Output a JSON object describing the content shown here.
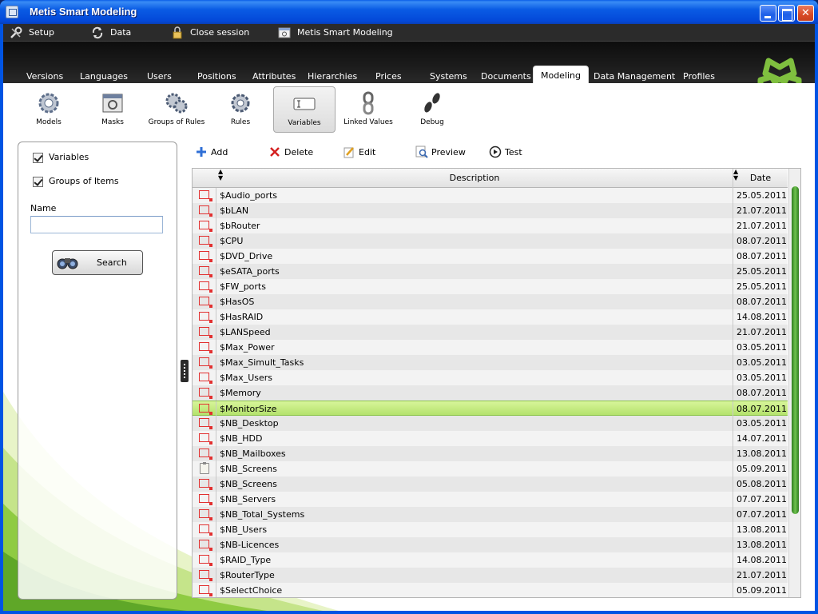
{
  "window": {
    "title": "Metis Smart Modeling"
  },
  "menu": [
    {
      "label": "Setup",
      "icon": "tools-icon"
    },
    {
      "label": "Data",
      "icon": "refresh-icon"
    },
    {
      "label": "Close session",
      "icon": "lock-icon"
    },
    {
      "label": "Metis Smart Modeling",
      "icon": "app-window-icon"
    }
  ],
  "tabs": [
    "Versions",
    "Languages",
    "Users",
    "Positions",
    "Attributes",
    "Hierarchies",
    "Prices",
    "Systems",
    "Documents",
    "Modeling",
    "Data Management",
    "Profiles"
  ],
  "active_tab": "Modeling",
  "ribbon": [
    {
      "label": "Models",
      "icon": "gear-models-icon"
    },
    {
      "label": "Masks",
      "icon": "mask-icon"
    },
    {
      "label": "Groups of Rules",
      "icon": "gears-group-icon"
    },
    {
      "label": "Rules",
      "icon": "gear-rules-icon"
    },
    {
      "label": "Variables",
      "icon": "variable-field-icon"
    },
    {
      "label": "Linked Values",
      "icon": "chain-link-icon"
    },
    {
      "label": "Debug",
      "icon": "footsteps-icon"
    }
  ],
  "active_ribbon": "Variables",
  "filter": {
    "variables_label": "Variables",
    "variables_checked": true,
    "groups_label": "Groups of Items",
    "groups_checked": true,
    "name_label": "Name",
    "name_value": "",
    "search_label": "Search"
  },
  "actions": {
    "add": "Add",
    "delete": "Delete",
    "edit": "Edit",
    "preview": "Preview",
    "test": "Test"
  },
  "table": {
    "col_description": "Description",
    "col_date": "Date",
    "rows": [
      {
        "desc": "$Audio_ports",
        "date": "25.05.2011",
        "icon": "variable"
      },
      {
        "desc": "$bLAN",
        "date": "21.07.2011",
        "icon": "variable"
      },
      {
        "desc": "$bRouter",
        "date": "21.07.2011",
        "icon": "variable"
      },
      {
        "desc": "$CPU",
        "date": "08.07.2011",
        "icon": "variable"
      },
      {
        "desc": "$DVD_Drive",
        "date": "08.07.2011",
        "icon": "variable"
      },
      {
        "desc": "$eSATA_ports",
        "date": "25.05.2011",
        "icon": "variable"
      },
      {
        "desc": "$FW_ports",
        "date": "25.05.2011",
        "icon": "variable"
      },
      {
        "desc": "$HasOS",
        "date": "08.07.2011",
        "icon": "variable"
      },
      {
        "desc": "$HasRAID",
        "date": "14.08.2011",
        "icon": "variable"
      },
      {
        "desc": "$LANSpeed",
        "date": "21.07.2011",
        "icon": "variable"
      },
      {
        "desc": "$Max_Power",
        "date": "03.05.2011",
        "icon": "variable"
      },
      {
        "desc": "$Max_Simult_Tasks",
        "date": "03.05.2011",
        "icon": "variable"
      },
      {
        "desc": "$Max_Users",
        "date": "03.05.2011",
        "icon": "variable"
      },
      {
        "desc": "$Memory",
        "date": "08.07.2011",
        "icon": "variable"
      },
      {
        "desc": "$MonitorSize",
        "date": "08.07.2011",
        "icon": "variable",
        "selected": true
      },
      {
        "desc": "$NB_Desktop",
        "date": "03.05.2011",
        "icon": "variable"
      },
      {
        "desc": "$NB_HDD",
        "date": "14.07.2011",
        "icon": "variable"
      },
      {
        "desc": "$NB_Mailboxes",
        "date": "13.08.2011",
        "icon": "variable"
      },
      {
        "desc": "$NB_Screens",
        "date": "05.09.2011",
        "icon": "group"
      },
      {
        "desc": "$NB_Screens",
        "date": "05.08.2011",
        "icon": "variable"
      },
      {
        "desc": "$NB_Servers",
        "date": "07.07.2011",
        "icon": "variable"
      },
      {
        "desc": "$NB_Total_Systems",
        "date": "07.07.2011",
        "icon": "variable"
      },
      {
        "desc": "$NB_Users",
        "date": "13.08.2011",
        "icon": "variable"
      },
      {
        "desc": "$NB-Licences",
        "date": "13.08.2011",
        "icon": "variable"
      },
      {
        "desc": "$RAID_Type",
        "date": "14.08.2011",
        "icon": "variable"
      },
      {
        "desc": "$RouterType",
        "date": "21.07.2011",
        "icon": "variable"
      },
      {
        "desc": "$SelectChoice",
        "date": "05.09.2011",
        "icon": "variable"
      }
    ]
  },
  "colors": {
    "accent_green": "#8bc34a",
    "selected_row": "#c6ec86",
    "titlebar_blue": "#0a5be4",
    "header_dark": "#1c1c1c",
    "variable_icon_red": "#e23030"
  }
}
